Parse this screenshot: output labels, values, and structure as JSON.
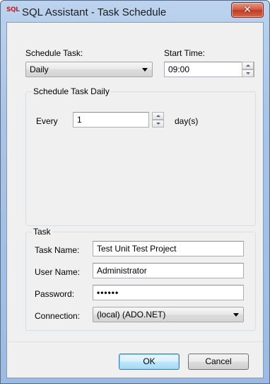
{
  "window": {
    "title": "SQL Assistant - Task Schedule",
    "app_icon_text": "SQL",
    "close_icon": "✕"
  },
  "schedule": {
    "schedule_task_label": "Schedule Task:",
    "schedule_task_value": "Daily",
    "start_time_label": "Start Time:",
    "start_time_value": "09:00"
  },
  "daily_group": {
    "title": "Schedule Task Daily",
    "every_label": "Every",
    "every_value": "1",
    "unit_label": "day(s)"
  },
  "task_group": {
    "title": "Task",
    "task_name_label": "Task Name:",
    "task_name_value": "Test Unit Test Project",
    "user_name_label": "User Name:",
    "user_name_value": "Administrator",
    "password_label": "Password:",
    "password_value": "••••••",
    "connection_label": "Connection:",
    "connection_value": "(local) (ADO.NET)"
  },
  "buttons": {
    "ok": "OK",
    "cancel": "Cancel"
  }
}
